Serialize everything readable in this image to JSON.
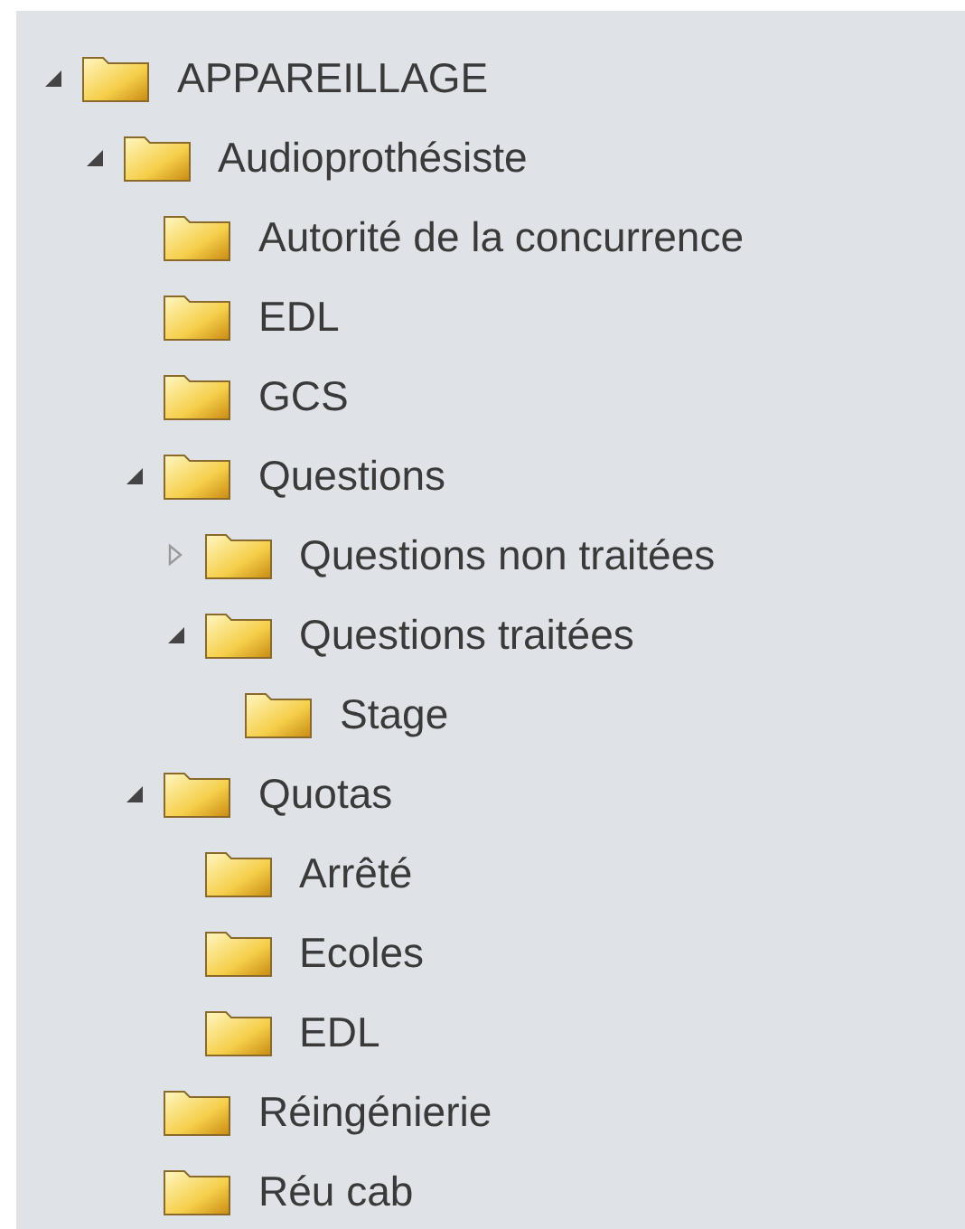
{
  "tree": [
    {
      "label": "APPAREILLAGE",
      "expanded": true,
      "children": [
        {
          "label": "Audioprothésiste",
          "expanded": true,
          "children": [
            {
              "label": "Autorité de la concurrence"
            },
            {
              "label": "EDL"
            },
            {
              "label": "GCS"
            },
            {
              "label": "Questions",
              "expanded": true,
              "children": [
                {
                  "label": "Questions non traitées",
                  "expanded": false
                },
                {
                  "label": "Questions traitées",
                  "expanded": true,
                  "children": [
                    {
                      "label": "Stage"
                    }
                  ]
                }
              ]
            },
            {
              "label": "Quotas",
              "expanded": true,
              "children": [
                {
                  "label": "Arrêté"
                },
                {
                  "label": "Ecoles"
                },
                {
                  "label": "EDL"
                }
              ]
            },
            {
              "label": "Réingénierie"
            },
            {
              "label": "Réu cab"
            }
          ]
        }
      ]
    }
  ]
}
